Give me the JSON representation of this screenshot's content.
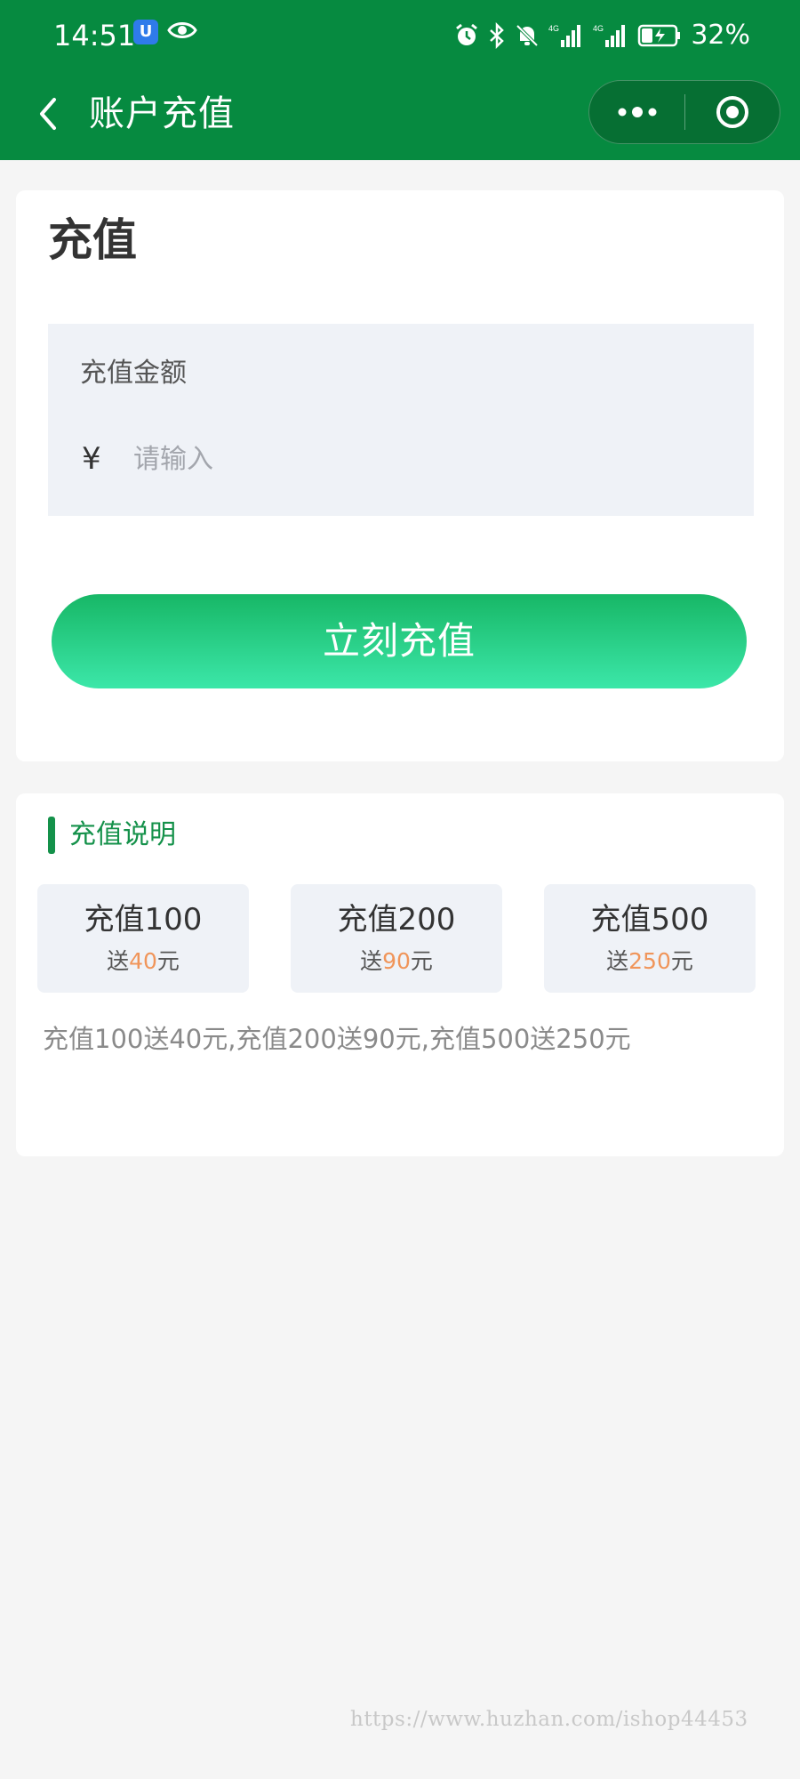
{
  "status_bar": {
    "time": "14:51",
    "battery": "32%",
    "icons": [
      "shield-app-icon",
      "eye-icon",
      "alarm-icon",
      "bluetooth-icon",
      "mute-icon",
      "signal-4g-icon",
      "signal-4g-icon",
      "battery-charging-icon"
    ]
  },
  "nav": {
    "title": "账户充值",
    "back_icon": "chevron-left-icon",
    "more_icon": "more-dots-icon",
    "close_icon": "target-icon"
  },
  "recharge": {
    "title": "充值",
    "amount_label": "充值金额",
    "currency": "¥",
    "placeholder": "请输入",
    "value": "",
    "button_label": "立刻充值"
  },
  "info": {
    "title": "充值说明",
    "options": [
      {
        "label": "充值100",
        "bonus_prefix": "送",
        "bonus": "40",
        "bonus_suffix": "元"
      },
      {
        "label": "充值200",
        "bonus_prefix": "送",
        "bonus": "90",
        "bonus_suffix": "元"
      },
      {
        "label": "充值500",
        "bonus_prefix": "送",
        "bonus": "250",
        "bonus_suffix": "元"
      }
    ],
    "description": "充值100送40元,充值200送90元,充值500送250元"
  },
  "watermark": "https://www.huzhan.com/ishop44453",
  "colors": {
    "header": "#068a40",
    "accent_green": "#14914a",
    "button_gradient_top": "#17b766",
    "button_gradient_bottom": "#3ce7a9",
    "bonus_orange": "#f0955a",
    "input_background": "#eff2f7"
  }
}
